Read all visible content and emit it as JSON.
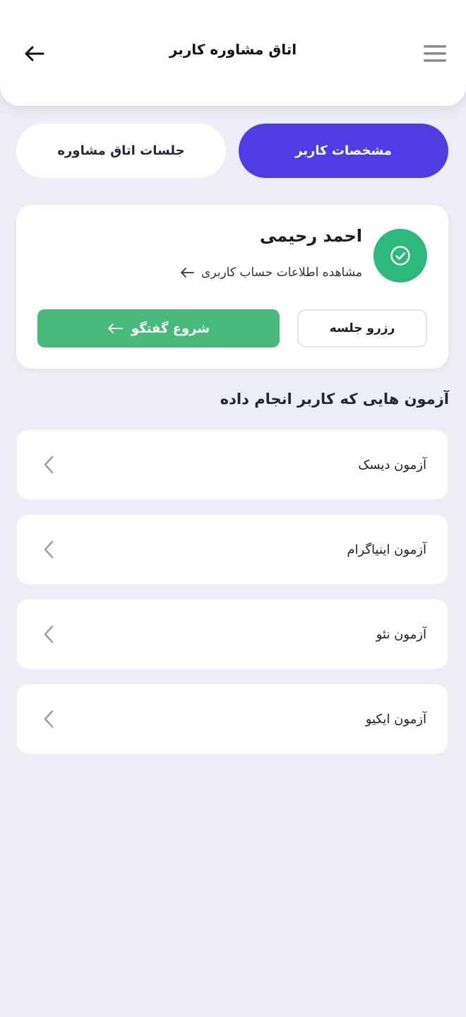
{
  "header": {
    "title": "اتاق مشاوره کاربر",
    "back_icon": "arrow-left-icon",
    "menu_icon": "hamburger-menu-icon"
  },
  "tabs": [
    {
      "label": "مشخصات کاربر",
      "active": true
    },
    {
      "label": "جلسات اتاق مشاوره",
      "active": false
    }
  ],
  "user": {
    "name": "احمد رحیمی",
    "view_account_label": "مشاهده اطلاعات حساب کاربری",
    "badge_icon": "check-circle-icon",
    "reserve_label": "رزرو جلسه",
    "chat_label": "شروع گفتگو"
  },
  "tests_section": {
    "title": "آزمون هایی که کاربر انجام داده",
    "items": [
      {
        "label": "آزمون دیسک"
      },
      {
        "label": "آزمون اینیاگرام"
      },
      {
        "label": "آزمون نئو"
      },
      {
        "label": "آزمون ایکیو"
      }
    ]
  },
  "colors": {
    "accent": "#4f3de3",
    "success": "#47b97b",
    "badge": "#2eb87c",
    "background": "#ecedf6"
  }
}
